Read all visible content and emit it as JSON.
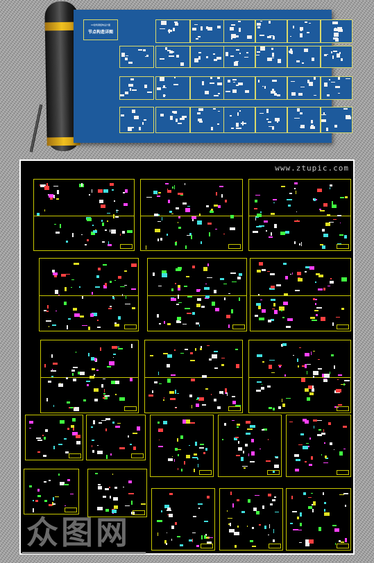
{
  "preview": {
    "subtitle": "XX建筑钢结构设计图",
    "title": "节点构造详图"
  },
  "panel": {
    "url": "www.ztupic.com"
  },
  "watermark": {
    "text": "众图网"
  },
  "colors": {
    "sheet_blue": "#1d5a9c",
    "line_yellow": "#c8c800",
    "background": "#000000"
  }
}
